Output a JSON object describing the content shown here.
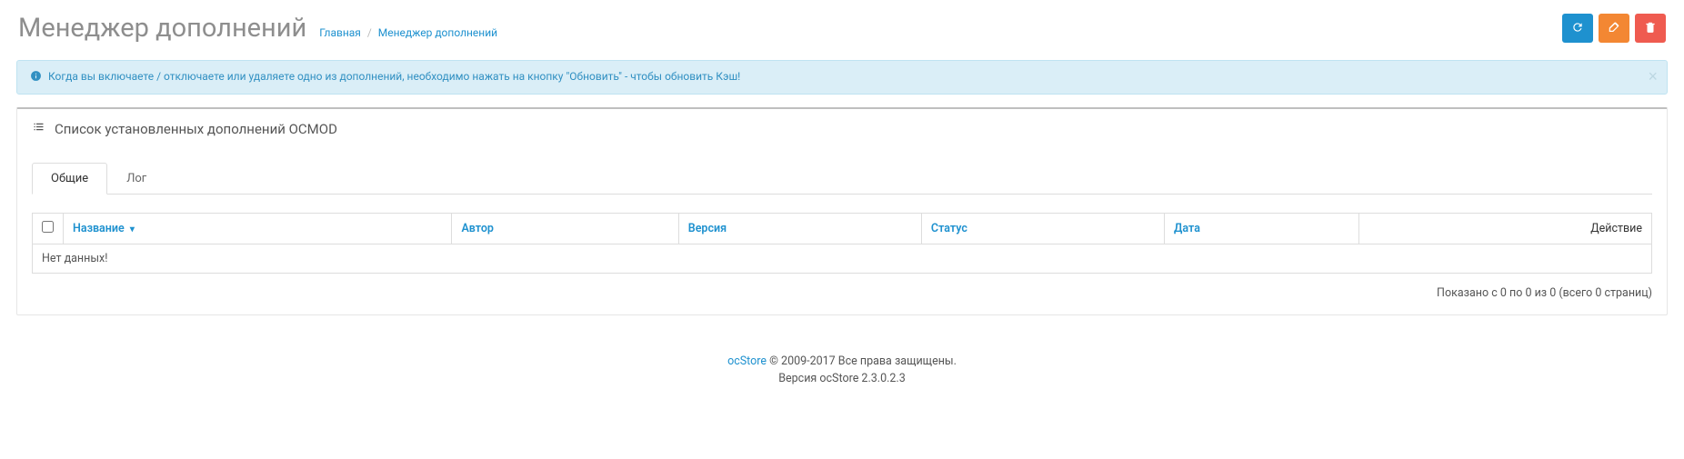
{
  "header": {
    "title": "Менеджер дополнений",
    "breadcrumb": {
      "home": "Главная",
      "current": "Менеджер дополнений"
    }
  },
  "alert": {
    "text": "Когда вы включаете / отключаете или удаляете одно из дополнений, необходимо нажать на кнопку \"Обновить\" - чтобы обновить Кэш!"
  },
  "panel": {
    "heading": "Список установленных дополнений OCMOD"
  },
  "tabs": {
    "general": "Общие",
    "log": "Лог"
  },
  "table": {
    "columns": {
      "name": "Название",
      "author": "Автор",
      "version": "Версия",
      "status": "Статус",
      "date": "Дата",
      "action": "Действие"
    },
    "empty": "Нет данных!"
  },
  "pagination": "Показано с 0 по 0 из 0 (всего 0 страниц)",
  "footer": {
    "brand": "ocStore",
    "copyright": " © 2009-2017 Все права защищены.",
    "version": "Версия ocStore 2.3.0.2.3"
  }
}
